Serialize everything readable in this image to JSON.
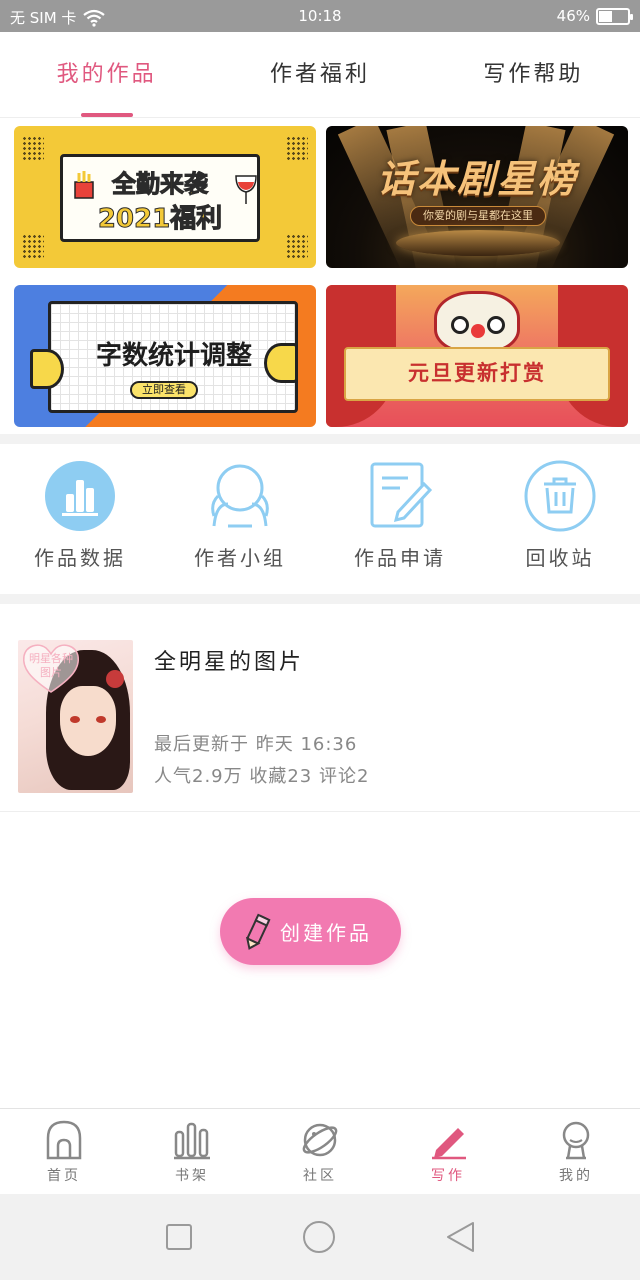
{
  "status_bar": {
    "carrier": "无 SIM 卡",
    "time": "10:18",
    "battery": "46%",
    "battery_level": 0.46
  },
  "top_tabs": [
    {
      "label": "我的作品",
      "active": true
    },
    {
      "label": "作者福利",
      "active": false
    },
    {
      "label": "写作帮助",
      "active": false
    }
  ],
  "banners": {
    "b1": {
      "line1": "全勤来袭",
      "line2": "2021福利"
    },
    "b2": {
      "title": "话本剧星榜",
      "subtitle": "你爱的剧与星都在这里"
    },
    "b3": {
      "title": "字数统计调整",
      "button": "立即查看"
    },
    "b4": {
      "title": "元旦更新打赏"
    }
  },
  "quick_actions": [
    {
      "label": "作品数据",
      "icon": "bar-chart-icon"
    },
    {
      "label": "作者小组",
      "icon": "group-avatar-icon"
    },
    {
      "label": "作品申请",
      "icon": "edit-document-icon"
    },
    {
      "label": "回收站",
      "icon": "trash-icon"
    }
  ],
  "work": {
    "cover_text": "明星各种图片",
    "title": "全明星的图片",
    "updated": "最后更新于 昨天 16:36",
    "stats": "人气2.9万 收藏23 评论2"
  },
  "create_button": {
    "label": "创建作品",
    "icon": "pencil-icon"
  },
  "bottom_tabs": [
    {
      "label": "首页",
      "icon": "home-icon",
      "active": false
    },
    {
      "label": "书架",
      "icon": "bookshelf-icon",
      "active": false
    },
    {
      "label": "社区",
      "icon": "planet-icon",
      "active": false
    },
    {
      "label": "写作",
      "icon": "pen-icon",
      "active": true
    },
    {
      "label": "我的",
      "icon": "profile-icon",
      "active": false
    }
  ],
  "colors": {
    "accent": "#e0587f",
    "create_button": "#f27ab1",
    "icon_blue": "#8ecdf2"
  }
}
